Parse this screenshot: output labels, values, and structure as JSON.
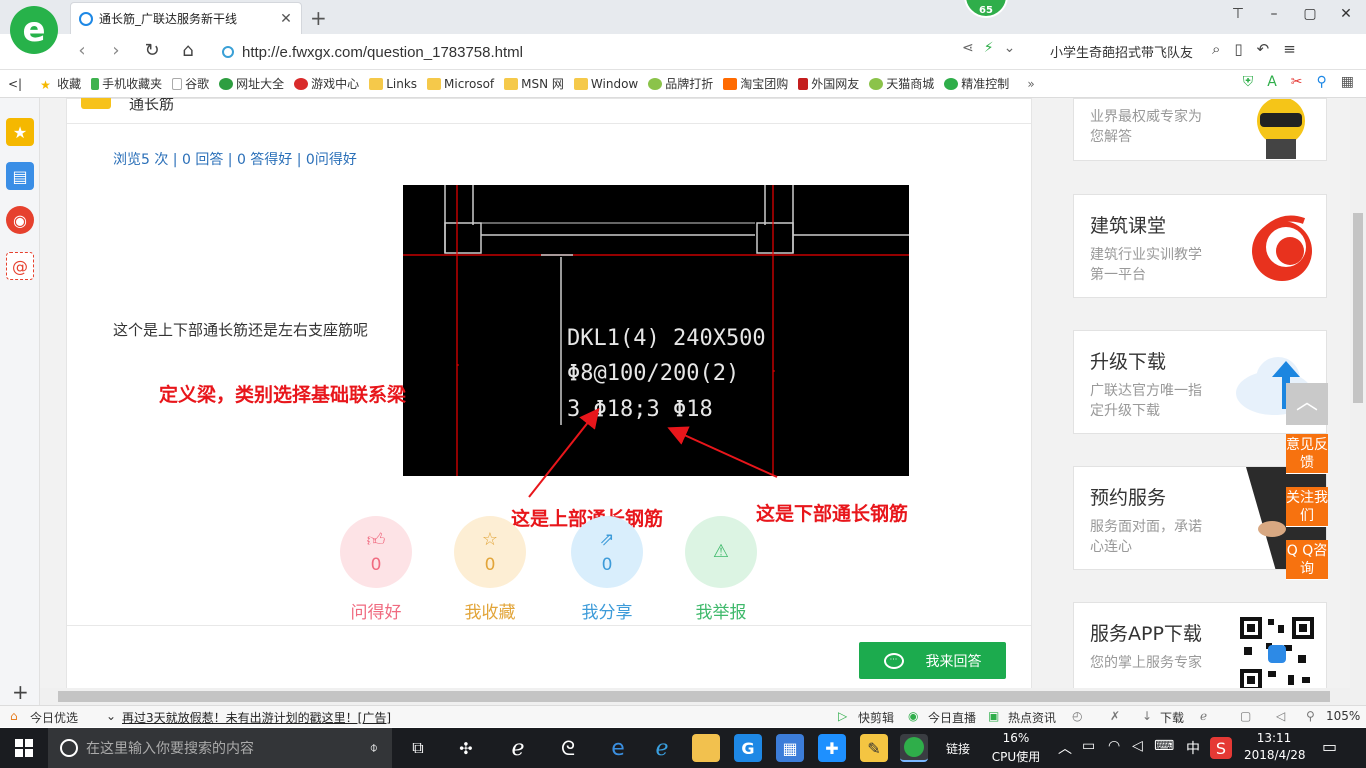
{
  "browser": {
    "tab_title": "通长筋_广联达服务新干线",
    "tab_close": "✕",
    "new_tab": "+",
    "score_badge": "65",
    "url": "http://e.fwxgx.com/question_1783758.html",
    "search_hint": "小学生奇葩招式带飞队友",
    "bookmarks": [
      {
        "label": "收藏",
        "icon": "star-icon"
      },
      {
        "label": "手机收藏夹",
        "icon": "phone-icon"
      },
      {
        "label": "谷歌",
        "icon": "page-icon"
      },
      {
        "label": "网址大全",
        "icon": "globe-icon"
      },
      {
        "label": "游戏中心",
        "icon": "game-icon"
      },
      {
        "label": "Links",
        "icon": "folder-icon"
      },
      {
        "label": "Microsof",
        "icon": "folder-icon"
      },
      {
        "label": "MSN 网",
        "icon": "folder-icon"
      },
      {
        "label": "Window",
        "icon": "folder-icon"
      },
      {
        "label": "品牌打折",
        "icon": "leaf-icon"
      },
      {
        "label": "淘宝团购",
        "icon": "taobao-icon"
      },
      {
        "label": "外国网友",
        "icon": "flag-icon"
      },
      {
        "label": "天猫商城",
        "icon": "leaf-icon"
      },
      {
        "label": "精准控制",
        "icon": "chat-icon"
      }
    ],
    "bookmarks_more": "»"
  },
  "question": {
    "title": "通长筋",
    "stats": "浏览5 次 | 0 回答 | 0 答得好 | 0问得好",
    "text": "这个是上下部通长筋还是左右支座筋呢",
    "cad_lines": [
      "DKL1(4)     240X500",
      "Φ8@100/200(2)",
      "3 Φ18;3   Φ18"
    ],
    "annotations": {
      "left_note": "定义梁，类别选择基础联系梁",
      "top_rebar": "这是上部通长钢筋",
      "bottom_rebar": "这是下部通长钢筋"
    }
  },
  "actions": [
    {
      "label": "问得好",
      "count": "0",
      "icon": "thumbs-up-icon",
      "color": "#f06b80",
      "bg": "#fde3e6"
    },
    {
      "label": "我收藏",
      "count": "0",
      "icon": "star-outline-icon",
      "color": "#e2a53a",
      "bg": "#fdeed4"
    },
    {
      "label": "我分享",
      "count": "0",
      "icon": "share-icon",
      "color": "#3d9bd9",
      "bg": "#d9eefc"
    },
    {
      "label": "我举报",
      "count": "0",
      "icon": "warning-icon",
      "color": "#3fb96b",
      "bg": "#dcf4e3"
    }
  ],
  "answer_button": "我来回答",
  "right_cards": [
    {
      "title": "",
      "desc": "业界最权威专家为您解答"
    },
    {
      "title": "建筑课堂",
      "desc": "建筑行业实训教学第一平台"
    },
    {
      "title": "升级下载",
      "desc": "广联达官方唯一指定升级下载"
    },
    {
      "title": "预约服务",
      "desc": "服务面对面，承诺心连心"
    },
    {
      "title": "服务APP下载",
      "desc": "您的掌上服务专家"
    }
  ],
  "floating": {
    "back_top": "︿",
    "feedback": "意见反馈",
    "follow": "关注我们",
    "qq": "Q Q咨询"
  },
  "statusbar": {
    "today": "今日优选",
    "ad": "再过3天就放假惹！未有出游计划的戳这里！[广告]",
    "clip": "快剪辑",
    "live": "今日直播",
    "news": "热点资讯",
    "download": "下载",
    "zoom": "105%"
  },
  "taskbar": {
    "search_placeholder": "在这里输入你要搜索的内容",
    "link_label": "链接",
    "cpu_percent": "16%",
    "cpu_label": "CPU使用",
    "ime": "中",
    "time": "13:11",
    "date": "2018/4/28"
  },
  "colors": {
    "accent_green": "#1cab4e",
    "annotation_red": "#e8161b",
    "float_orange": "#f7720f"
  }
}
